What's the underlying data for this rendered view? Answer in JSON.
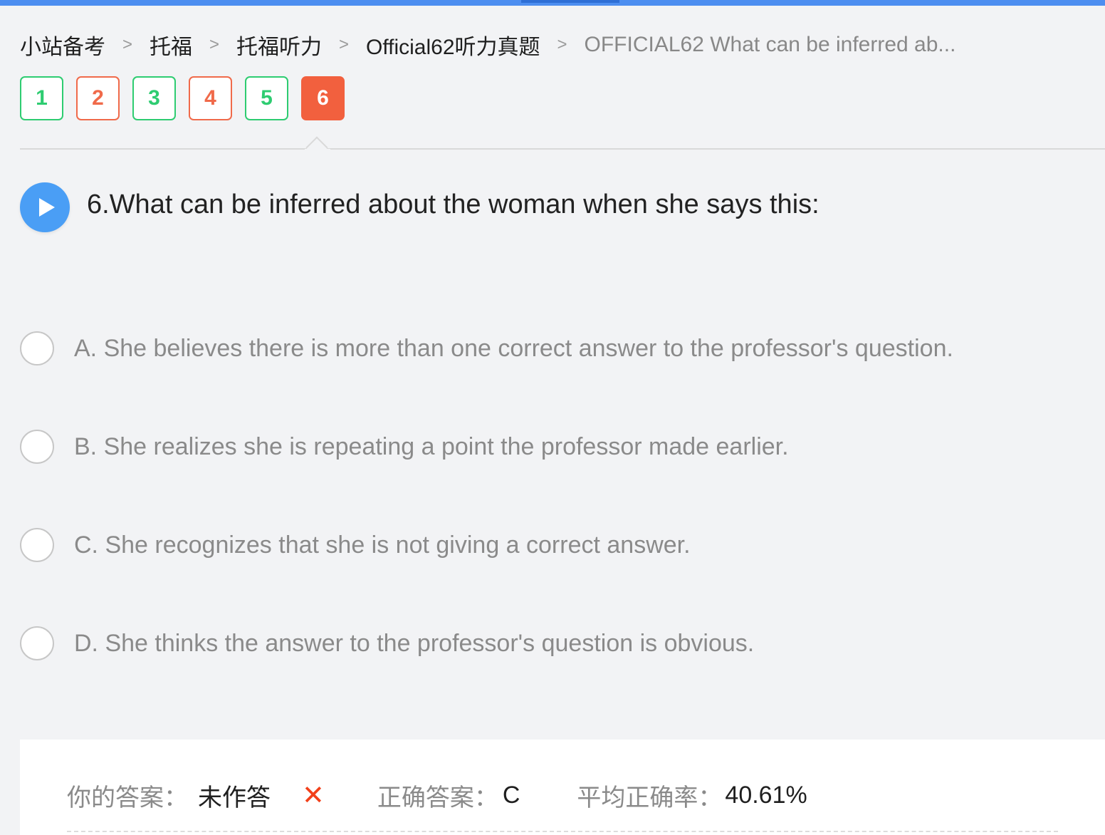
{
  "breadcrumb": {
    "items": [
      "小站备考",
      "托福",
      "托福听力",
      "Official62听力真题"
    ],
    "current": "OFFICIAL62 What can be inferred ab...",
    "separator": ">"
  },
  "question_nav": [
    {
      "label": "1",
      "state": "correct"
    },
    {
      "label": "2",
      "state": "wrong"
    },
    {
      "label": "3",
      "state": "correct"
    },
    {
      "label": "4",
      "state": "wrong"
    },
    {
      "label": "5",
      "state": "correct"
    },
    {
      "label": "6",
      "state": "current"
    }
  ],
  "question": {
    "text": "6.What can be inferred about the woman when she says this:",
    "play_icon": "play-icon"
  },
  "options": [
    {
      "letter": "A",
      "text": "A. She believes there is more than one correct answer to the professor's question."
    },
    {
      "letter": "B",
      "text": "B. She realizes she is repeating a point the professor made earlier."
    },
    {
      "letter": "C",
      "text": "C. She recognizes that she is not giving a correct answer."
    },
    {
      "letter": "D",
      "text": "D. She thinks the answer to the professor's question is obvious."
    }
  ],
  "answer": {
    "your_answer_label": "你的答案：",
    "your_answer_value": "未作答",
    "wrong_mark": "✕",
    "correct_answer_label": "正确答案：",
    "correct_answer_value": "C",
    "avg_rate_label": "平均正确率：",
    "avg_rate_value": "40.61%"
  },
  "colors": {
    "accent": "#4d8ef0",
    "correct": "#2ecc71",
    "wrong": "#f06a4a",
    "current": "#f2603e",
    "play_button": "#4a9ef5"
  }
}
